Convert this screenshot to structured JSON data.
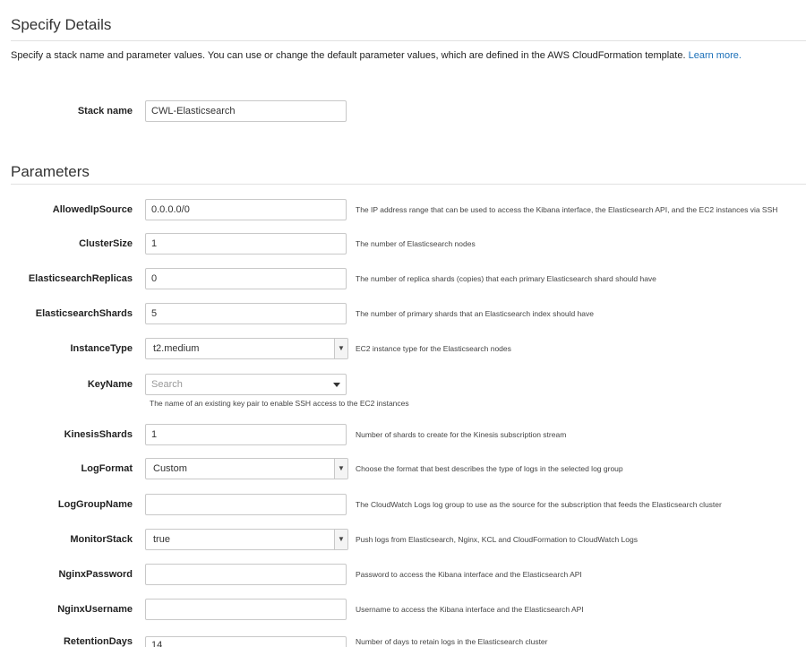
{
  "details": {
    "heading": "Specify Details",
    "intro": "Specify a stack name and parameter values. You can use or change the default parameter values, which are defined in the AWS CloudFormation template.",
    "learn_more": "Learn more.",
    "stack_name_label": "Stack name",
    "stack_name_value": "CWL-Elasticsearch"
  },
  "parameters": {
    "heading": "Parameters",
    "allowed_ip_source": {
      "label": "AllowedIpSource",
      "value": "0.0.0.0/0",
      "help": "The IP address range that can be used to access the Kibana interface, the Elasticsearch API, and the EC2 instances via SSH"
    },
    "cluster_size": {
      "label": "ClusterSize",
      "value": "1",
      "help": "The number of Elasticsearch nodes"
    },
    "es_replicas": {
      "label": "ElasticsearchReplicas",
      "value": "0",
      "help": "The number of replica shards (copies) that each primary Elasticsearch shard should have"
    },
    "es_shards": {
      "label": "ElasticsearchShards",
      "value": "5",
      "help": "The number of primary shards that an Elasticsearch index should have"
    },
    "instance_type": {
      "label": "InstanceType",
      "value": "t2.medium",
      "help": "EC2 instance type for the Elasticsearch nodes"
    },
    "key_name": {
      "label": "KeyName",
      "placeholder": "Search",
      "help": "The name of an existing key pair to enable SSH access to the EC2 instances"
    },
    "kinesis_shards": {
      "label": "KinesisShards",
      "value": "1",
      "help": "Number of shards to create for the Kinesis subscription stream"
    },
    "log_format": {
      "label": "LogFormat",
      "value": "Custom",
      "help": "Choose the format that best describes the type of logs in the selected log group"
    },
    "log_group_name": {
      "label": "LogGroupName",
      "value": "",
      "help": "The CloudWatch Logs log group to use as the source for the subscription that feeds the Elasticsearch cluster"
    },
    "monitor_stack": {
      "label": "MonitorStack",
      "value": "true",
      "help": "Push logs from Elasticsearch, Nginx, KCL and CloudFormation to CloudWatch Logs"
    },
    "nginx_password": {
      "label": "NginxPassword",
      "value": "",
      "help": "Password to access the Kibana interface and the Elasticsearch API"
    },
    "nginx_username": {
      "label": "NginxUsername",
      "value": "",
      "help": "Username to access the Kibana interface and the Elasticsearch API"
    },
    "retention_days": {
      "label": "RetentionDays",
      "value": "14",
      "help": "Number of days to retain logs in the Elasticsearch cluster"
    }
  },
  "icons": {
    "select_arrow": "chevron-down-icon",
    "combo_caret": "caret-down-icon"
  },
  "colors": {
    "link": "#1a6fb8",
    "border": "#c8c8c8",
    "rule": "#e1e1e1"
  }
}
